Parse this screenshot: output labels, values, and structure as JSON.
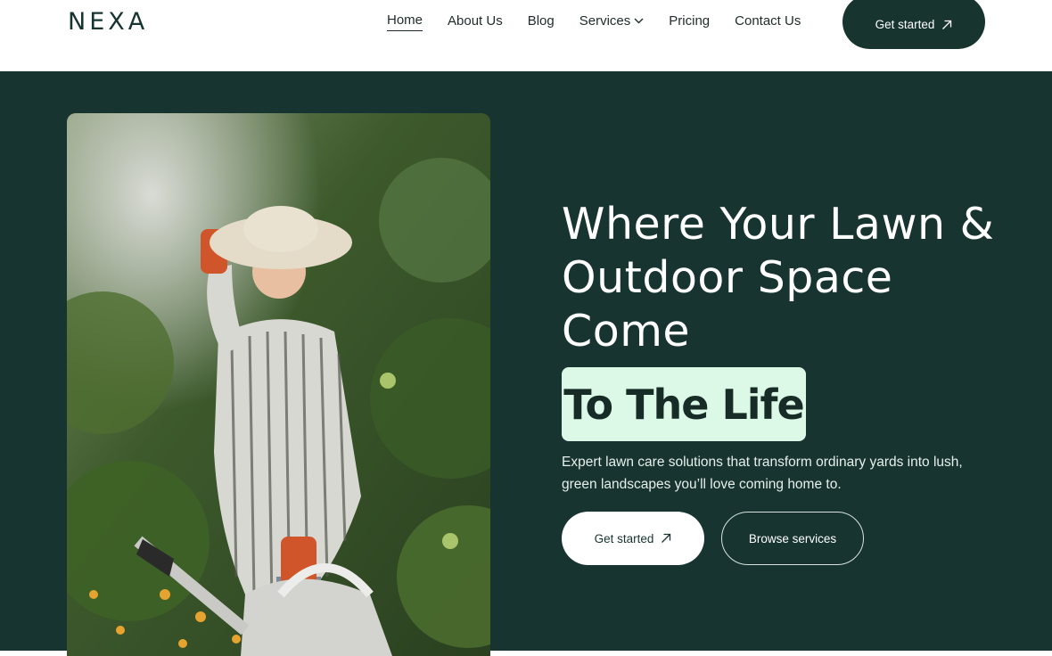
{
  "brand": {
    "logo_text": "NEXA"
  },
  "nav": {
    "items": [
      {
        "label": "Home",
        "active": true
      },
      {
        "label": "About Us"
      },
      {
        "label": "Blog"
      },
      {
        "label": "Services",
        "has_dropdown": true
      },
      {
        "label": "Pricing"
      },
      {
        "label": "Contact Us"
      }
    ],
    "cta_label": "Get started",
    "cta_icon": "arrow-up-right-icon"
  },
  "hero": {
    "headline": "Where Your Lawn & Outdoor Space Come",
    "highlight": "To The Life",
    "subtitle": "Expert lawn care solutions that transform ordinary yards into lush, green landscapes you’ll love coming home to.",
    "primary_button": "Get started",
    "secondary_button": "Browse services",
    "image_subject": "woman-gardener-with-watering-can"
  },
  "colors": {
    "brand_dark": "#173430",
    "highlight_bg": "#dcf8e6",
    "white": "#ffffff"
  }
}
